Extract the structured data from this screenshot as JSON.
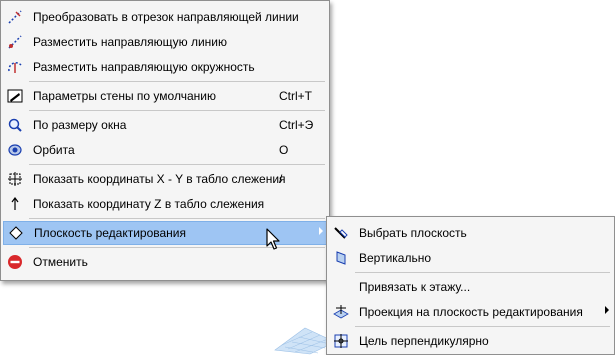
{
  "main_menu": {
    "items": [
      {
        "label": "Преобразовать в отрезок направляющей линии",
        "shortcut": "",
        "icon": "guide-segment-icon"
      },
      {
        "label": "Разместить направляющую линию",
        "shortcut": "",
        "icon": "guide-line-icon"
      },
      {
        "label": "Разместить направляющую окружность",
        "shortcut": "",
        "icon": "guide-circle-icon"
      },
      {
        "label": "Параметры стены по умолчанию",
        "shortcut": "Ctrl+T",
        "icon": "wall-settings-icon"
      },
      {
        "label": "По размеру окна",
        "shortcut": "Ctrl+Э",
        "icon": "zoom-fit-icon"
      },
      {
        "label": "Орбита",
        "shortcut": "O",
        "icon": "orbit-icon"
      },
      {
        "label": "Показать координаты X - Y в табло слежения",
        "shortcut": "/",
        "icon": "xy-coords-icon"
      },
      {
        "label": "Показать координату Z в табло слежения",
        "shortcut": "",
        "icon": "z-coord-icon"
      },
      {
        "label": "Плоскость редактирования",
        "shortcut": "",
        "icon": "editing-plane-icon"
      },
      {
        "label": "Отменить",
        "shortcut": "",
        "icon": "cancel-icon"
      }
    ]
  },
  "sub_menu": {
    "items": [
      {
        "label": "Выбрать плоскость",
        "icon": "pick-plane-icon"
      },
      {
        "label": "Вертикально",
        "icon": "vertical-plane-icon"
      },
      {
        "label": "Привязать к этажу...",
        "icon": ""
      },
      {
        "label": "Проекция на плоскость редактирования",
        "icon": "projection-icon"
      },
      {
        "label": "Цель перпендикулярно",
        "icon": "target-perpendicular-icon"
      }
    ]
  },
  "colors": {
    "highlight": "#9ec5f3",
    "menu_bg": "#f5f5f5",
    "cancel_red": "#d9282b"
  }
}
